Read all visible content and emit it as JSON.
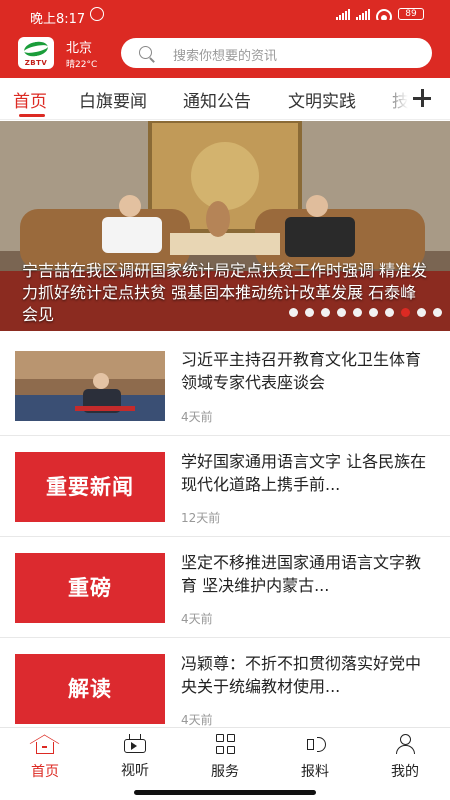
{
  "status_bar": {
    "time": "晚上8:17",
    "battery": "89"
  },
  "header": {
    "logo_text": "ZBTV",
    "city": "北京",
    "weather": "晴22°C",
    "search_placeholder": "搜索你想要的资讯"
  },
  "tabs": [
    {
      "label": "首页",
      "active": true
    },
    {
      "label": "白旗要闻",
      "active": false
    },
    {
      "label": "通知公告",
      "active": false
    },
    {
      "label": "文明实践",
      "active": false
    },
    {
      "label": "技",
      "active": false
    }
  ],
  "banner": {
    "caption": "宁吉喆在我区调研国家统计局定点扶贫工作时强调  精准发力抓好统计定点扶贫  强基固本推动统计改革发展  石泰峰会见",
    "dot_count": 10,
    "active_dot": 7
  },
  "news": [
    {
      "thumb_text": "",
      "title": "习近平主持召开教育文化卫生体育领域专家代表座谈会",
      "time": "4天前"
    },
    {
      "thumb_text": "重要新闻",
      "title": "学好国家通用语言文字  让各民族在现代化道路上携手前...",
      "time": "12天前"
    },
    {
      "thumb_text": "重磅",
      "title": "坚定不移推进国家通用语言文字教育  坚决维护内蒙古...",
      "time": "4天前"
    },
    {
      "thumb_text": "解读",
      "title": "冯颖尊：不折不扣贯彻落实好党中央关于统编教材使用...",
      "time": "4天前"
    }
  ],
  "bottom_nav": [
    {
      "label": "首页",
      "icon": "home-icon",
      "active": true
    },
    {
      "label": "视听",
      "icon": "tv-icon",
      "active": false
    },
    {
      "label": "服务",
      "icon": "grid-icon",
      "active": false
    },
    {
      "label": "报料",
      "icon": "speaker-icon",
      "active": false
    },
    {
      "label": "我的",
      "icon": "user-icon",
      "active": false
    }
  ],
  "colors": {
    "brand_red": "#dc2a23",
    "thumb_red": "#dc2a2f"
  }
}
